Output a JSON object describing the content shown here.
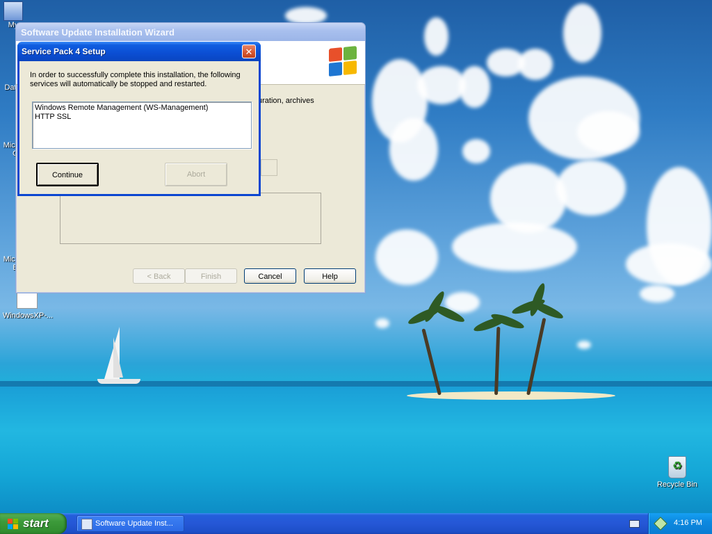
{
  "desktop": {
    "icons": [
      {
        "label": "My",
        "glyph": "computer-icon"
      },
      {
        "label": "Dat",
        "glyph": ""
      },
      {
        "label": "Micr",
        "label2": "C",
        "glyph": ""
      },
      {
        "label": "Micr",
        "label2": "B",
        "glyph": ""
      },
      {
        "label": "WindowsXP-...",
        "glyph": "folder-icon"
      },
      {
        "label": "Recycle Bin",
        "glyph": "recycle-bin-icon"
      }
    ]
  },
  "wizard": {
    "title": "Software Update Installation Wizard",
    "body_fragment": "uration, archives",
    "buttons": {
      "back": "< Back",
      "finish": "Finish",
      "cancel": "Cancel",
      "help": "Help"
    }
  },
  "dialog": {
    "title": "Service Pack 4 Setup",
    "close_glyph": "✕",
    "message": "In order to successfully complete this installation, the following services will automatically be stopped and restarted.",
    "services": [
      "Windows Remote Management (WS-Management)",
      "HTTP SSL"
    ],
    "buttons": {
      "continue": "Continue",
      "abort": "Abort"
    }
  },
  "taskbar": {
    "start_label": "start",
    "task_label": "Software Update Inst...",
    "clock": "4:16 PM"
  },
  "colors": {
    "dialog_titlebar": "#0b4ed3",
    "start_green": "#3c9a3a",
    "taskbar_blue": "#2557d6"
  }
}
